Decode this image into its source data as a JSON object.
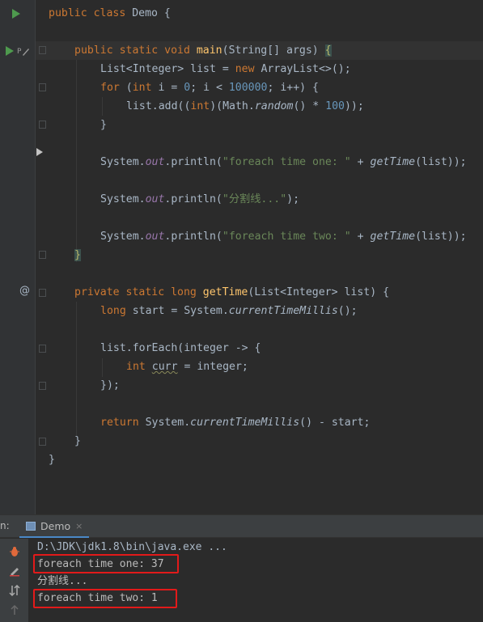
{
  "code": {
    "l1": {
      "kw": "public class ",
      "name": "Demo",
      "brace": " {"
    },
    "l2": {
      "kw": "public static void ",
      "fn": "main",
      "rest": "(String[] args) ",
      "brace": "{"
    },
    "l3": {
      "type": "List<Integer> list = ",
      "kw": "new ",
      "rest": "ArrayList<>();"
    },
    "l4": {
      "kw": "for ",
      "p1": "(",
      "kw2": "int ",
      "p2": "i = ",
      "n1": "0",
      "p3": "; i < ",
      "n2": "100000",
      "p4": "; i++) {"
    },
    "l5": {
      "p1": "list.add((",
      "kw": "int",
      "p2": ")(Math.",
      "it": "random",
      "p3": "() * ",
      "n": "100",
      "p4": "));"
    },
    "l6": "}",
    "l7": {
      "p1": "System.",
      "fld": "out",
      "p2": ".println(",
      "str": "\"foreach time one: \"",
      "p3": " + ",
      "it": "getTime",
      "p4": "(list));"
    },
    "l8": {
      "p1": "System.",
      "fld": "out",
      "p2": ".println(",
      "str": "\"分割线...\"",
      "p3": ");"
    },
    "l9": {
      "p1": "System.",
      "fld": "out",
      "p2": ".println(",
      "str": "\"foreach time two: \"",
      "p3": " + ",
      "it": "getTime",
      "p4": "(list));"
    },
    "l10": "}",
    "l11": {
      "kw": "private static long ",
      "fn": "getTime",
      "rest": "(List<Integer> list) {"
    },
    "l12": {
      "kw": "long ",
      "p1": "start = System.",
      "it": "currentTimeMillis",
      "p2": "();"
    },
    "l13": {
      "p1": "list.forEach(integer -> {"
    },
    "l14": {
      "kw": "int ",
      "var": "curr",
      "p1": " = integer;"
    },
    "l15": "});",
    "l16": {
      "kw": "return ",
      "p1": "System.",
      "it": "currentTimeMillis",
      "p2": "() - start;"
    },
    "l17": "}",
    "l18": "}"
  },
  "gutter": {
    "at_symbol": "@"
  },
  "run_panel": {
    "label": "n:",
    "tab_name": "Demo",
    "tab_close": "×",
    "output": [
      "D:\\JDK\\jdk1.8\\bin\\java.exe ...",
      "foreach time one: 37",
      "分割线...",
      "foreach time two: 1"
    ]
  },
  "colors": {
    "keyword": "#cc7832",
    "function": "#ffc66d",
    "number": "#6897bb",
    "string": "#6a8759",
    "field": "#9876aa",
    "highlight_box": "#e21a1a"
  }
}
